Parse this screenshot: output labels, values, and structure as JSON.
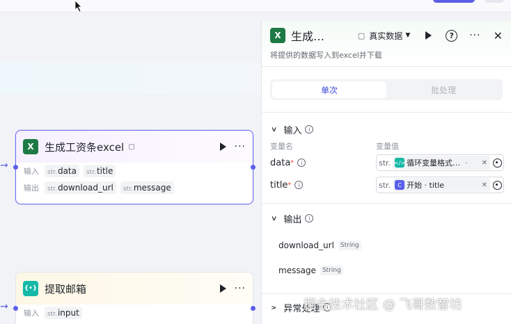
{
  "canvas": {
    "nodes": [
      {
        "title": "生成工资条excel",
        "inputs_label": "输入",
        "outputs_label": "输出",
        "inputs": [
          {
            "type": "str.",
            "name": "data"
          },
          {
            "type": "str.",
            "name": "title"
          }
        ],
        "outputs": [
          {
            "type": "str.",
            "name": "download_url"
          },
          {
            "type": "str.",
            "name": "message"
          }
        ]
      },
      {
        "title": "提取邮箱",
        "inputs_label": "输入",
        "inputs": [
          {
            "type": "str.",
            "name": "input"
          }
        ]
      }
    ]
  },
  "panel": {
    "title": "生成…",
    "mode_label": "真实数据",
    "description": "将提供的数据写入到excel并下载",
    "tabs": [
      {
        "label": "单次",
        "active": true
      },
      {
        "label": "批处理",
        "active": false
      }
    ],
    "input_section": {
      "title": "输入",
      "col_name": "变量名",
      "col_value": "变量值",
      "vars": [
        {
          "name": "data",
          "required": "*",
          "type": "str.",
          "source": "循环变量格式…",
          "suffix": "·",
          "icon": "code-icon",
          "icon_color": "#14b8a6"
        },
        {
          "name": "title",
          "required": "*",
          "type": "str.",
          "source": "开始 · title",
          "suffix": "",
          "icon": "start-icon",
          "icon_color": "#5b5fe8"
        }
      ]
    },
    "output_section": {
      "title": "输出",
      "vars": [
        {
          "name": "download_url",
          "type": "String"
        },
        {
          "name": "message",
          "type": "String"
        }
      ]
    },
    "error_section": {
      "title": "异常处理"
    }
  },
  "watermark": "掘金技术社区 @ 飞哥数智坊",
  "colors": {
    "accent": "#5b5fe8",
    "excel": "#1e7a45",
    "mail": "#14b8a6"
  }
}
